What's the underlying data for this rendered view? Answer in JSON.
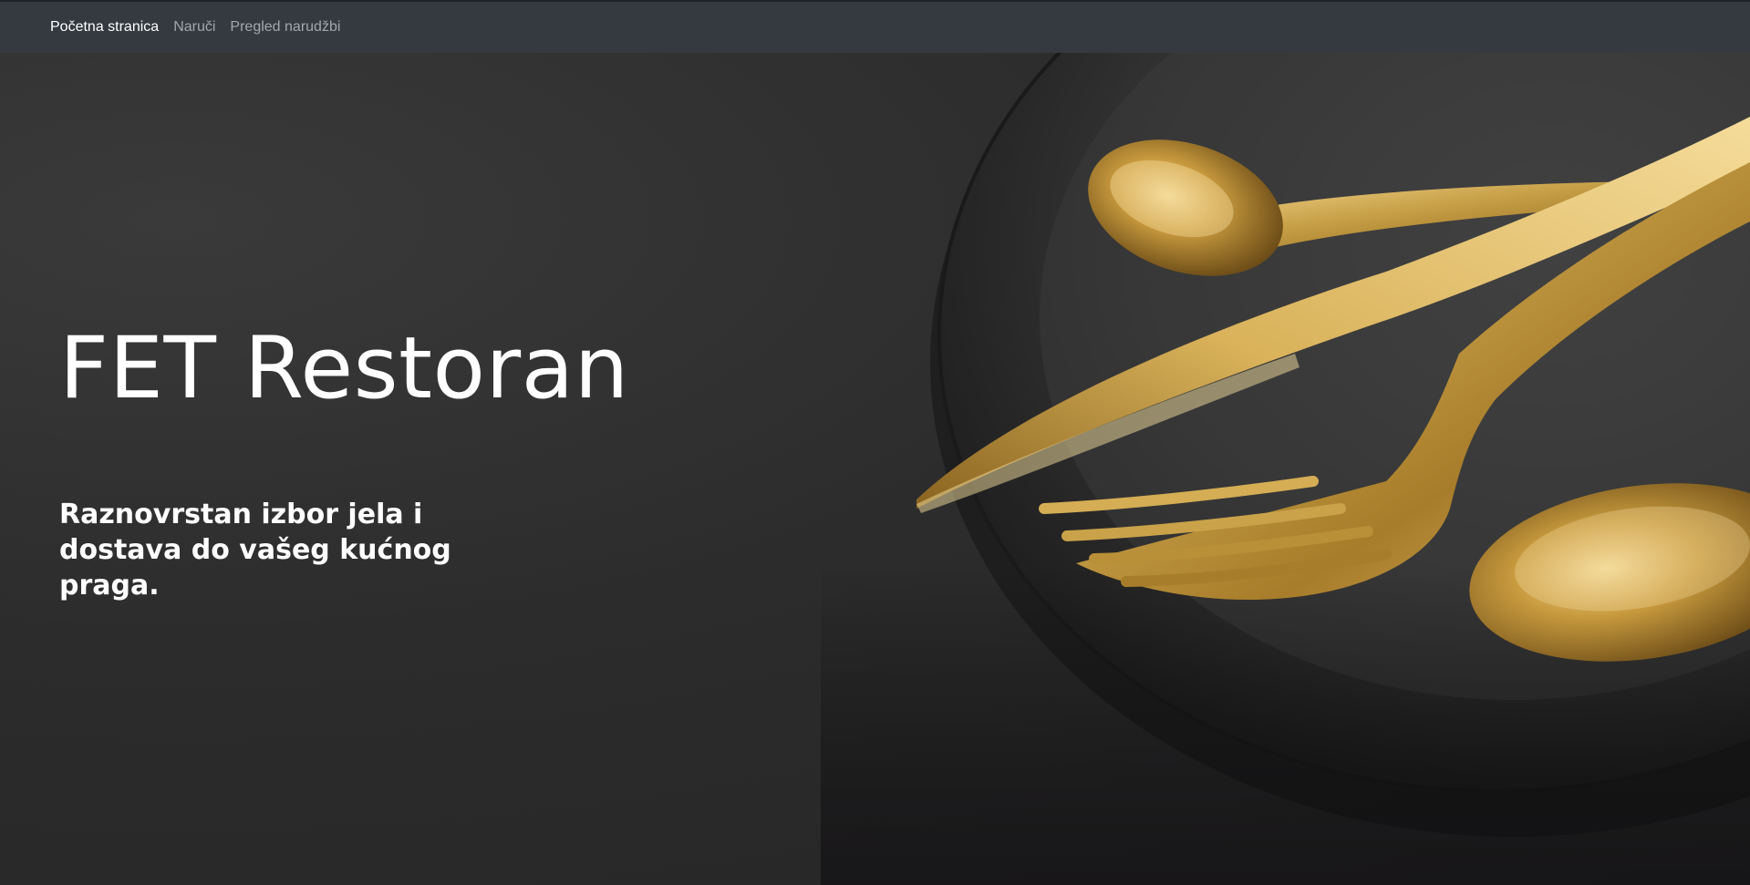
{
  "nav": {
    "items": [
      {
        "label": "Početna stranica",
        "active": true
      },
      {
        "label": "Naruči",
        "active": false
      },
      {
        "label": "Pregled narudžbi",
        "active": false
      }
    ]
  },
  "hero": {
    "title": "FET Restoran",
    "subtitle": "Raznovrstan izbor jela i dostava do vašeg kućnog praga.",
    "image": "gold-cutlery-on-black-plate"
  },
  "colors": {
    "navbar": "#343a40",
    "background": "#2b2b2b",
    "gold": "#c9a24a",
    "text": "#ffffff"
  }
}
